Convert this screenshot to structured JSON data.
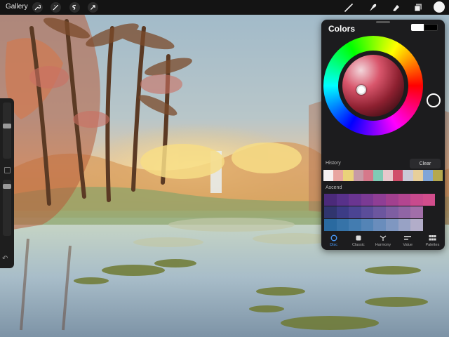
{
  "topbar": {
    "gallery_label": "Gallery",
    "tools_left": [
      "wrench-icon",
      "adjustments-wand-icon",
      "selection-icon",
      "transform-arrow-icon"
    ],
    "tools_right": [
      "brush-icon",
      "smudge-icon",
      "eraser-icon",
      "layers-icon"
    ],
    "active_color": "#f3f3f3"
  },
  "colors_panel": {
    "title": "Colors",
    "primary_color": "#ffffff",
    "secondary_color": "#000000",
    "history_label": "History",
    "clear_label": "Clear",
    "history": [
      "#f6f1f0",
      "#e8a5a0",
      "#ead27a",
      "#c79aa6",
      "#d6788a",
      "#7fcab5",
      "#e6c8cc",
      "#d04e6a",
      "#c9c9d8",
      "#e7cf9a",
      "#7fa5d8",
      "#b4a84e"
    ],
    "palette_name": "Ascend",
    "palette": [
      [
        "#4b2a7a",
        "#58318a",
        "#6a3591",
        "#7b3a94",
        "#8f3e95",
        "#a2408f",
        "#b34590",
        "#c84a8d",
        "#d24d8c"
      ],
      [
        "#30356e",
        "#3c3c86",
        "#4b4493",
        "#5b4d9a",
        "#6c569f",
        "#7e5ea2",
        "#9065a5",
        "#a26ea9"
      ],
      [
        "#2a6aa0",
        "#3673a8",
        "#437cb0",
        "#5484b6",
        "#6a8dbc",
        "#7f97c1",
        "#98a2c5",
        "#b2adc9"
      ]
    ],
    "tabs": [
      {
        "label": "Disc",
        "icon": "disc-icon",
        "active": true
      },
      {
        "label": "Classic",
        "icon": "classic-icon",
        "active": false
      },
      {
        "label": "Harmony",
        "icon": "harmony-icon",
        "active": false
      },
      {
        "label": "Value",
        "icon": "value-icon",
        "active": false
      },
      {
        "label": "Palettes",
        "icon": "palettes-icon",
        "active": false
      }
    ],
    "accent_color": "#4a9dff"
  }
}
